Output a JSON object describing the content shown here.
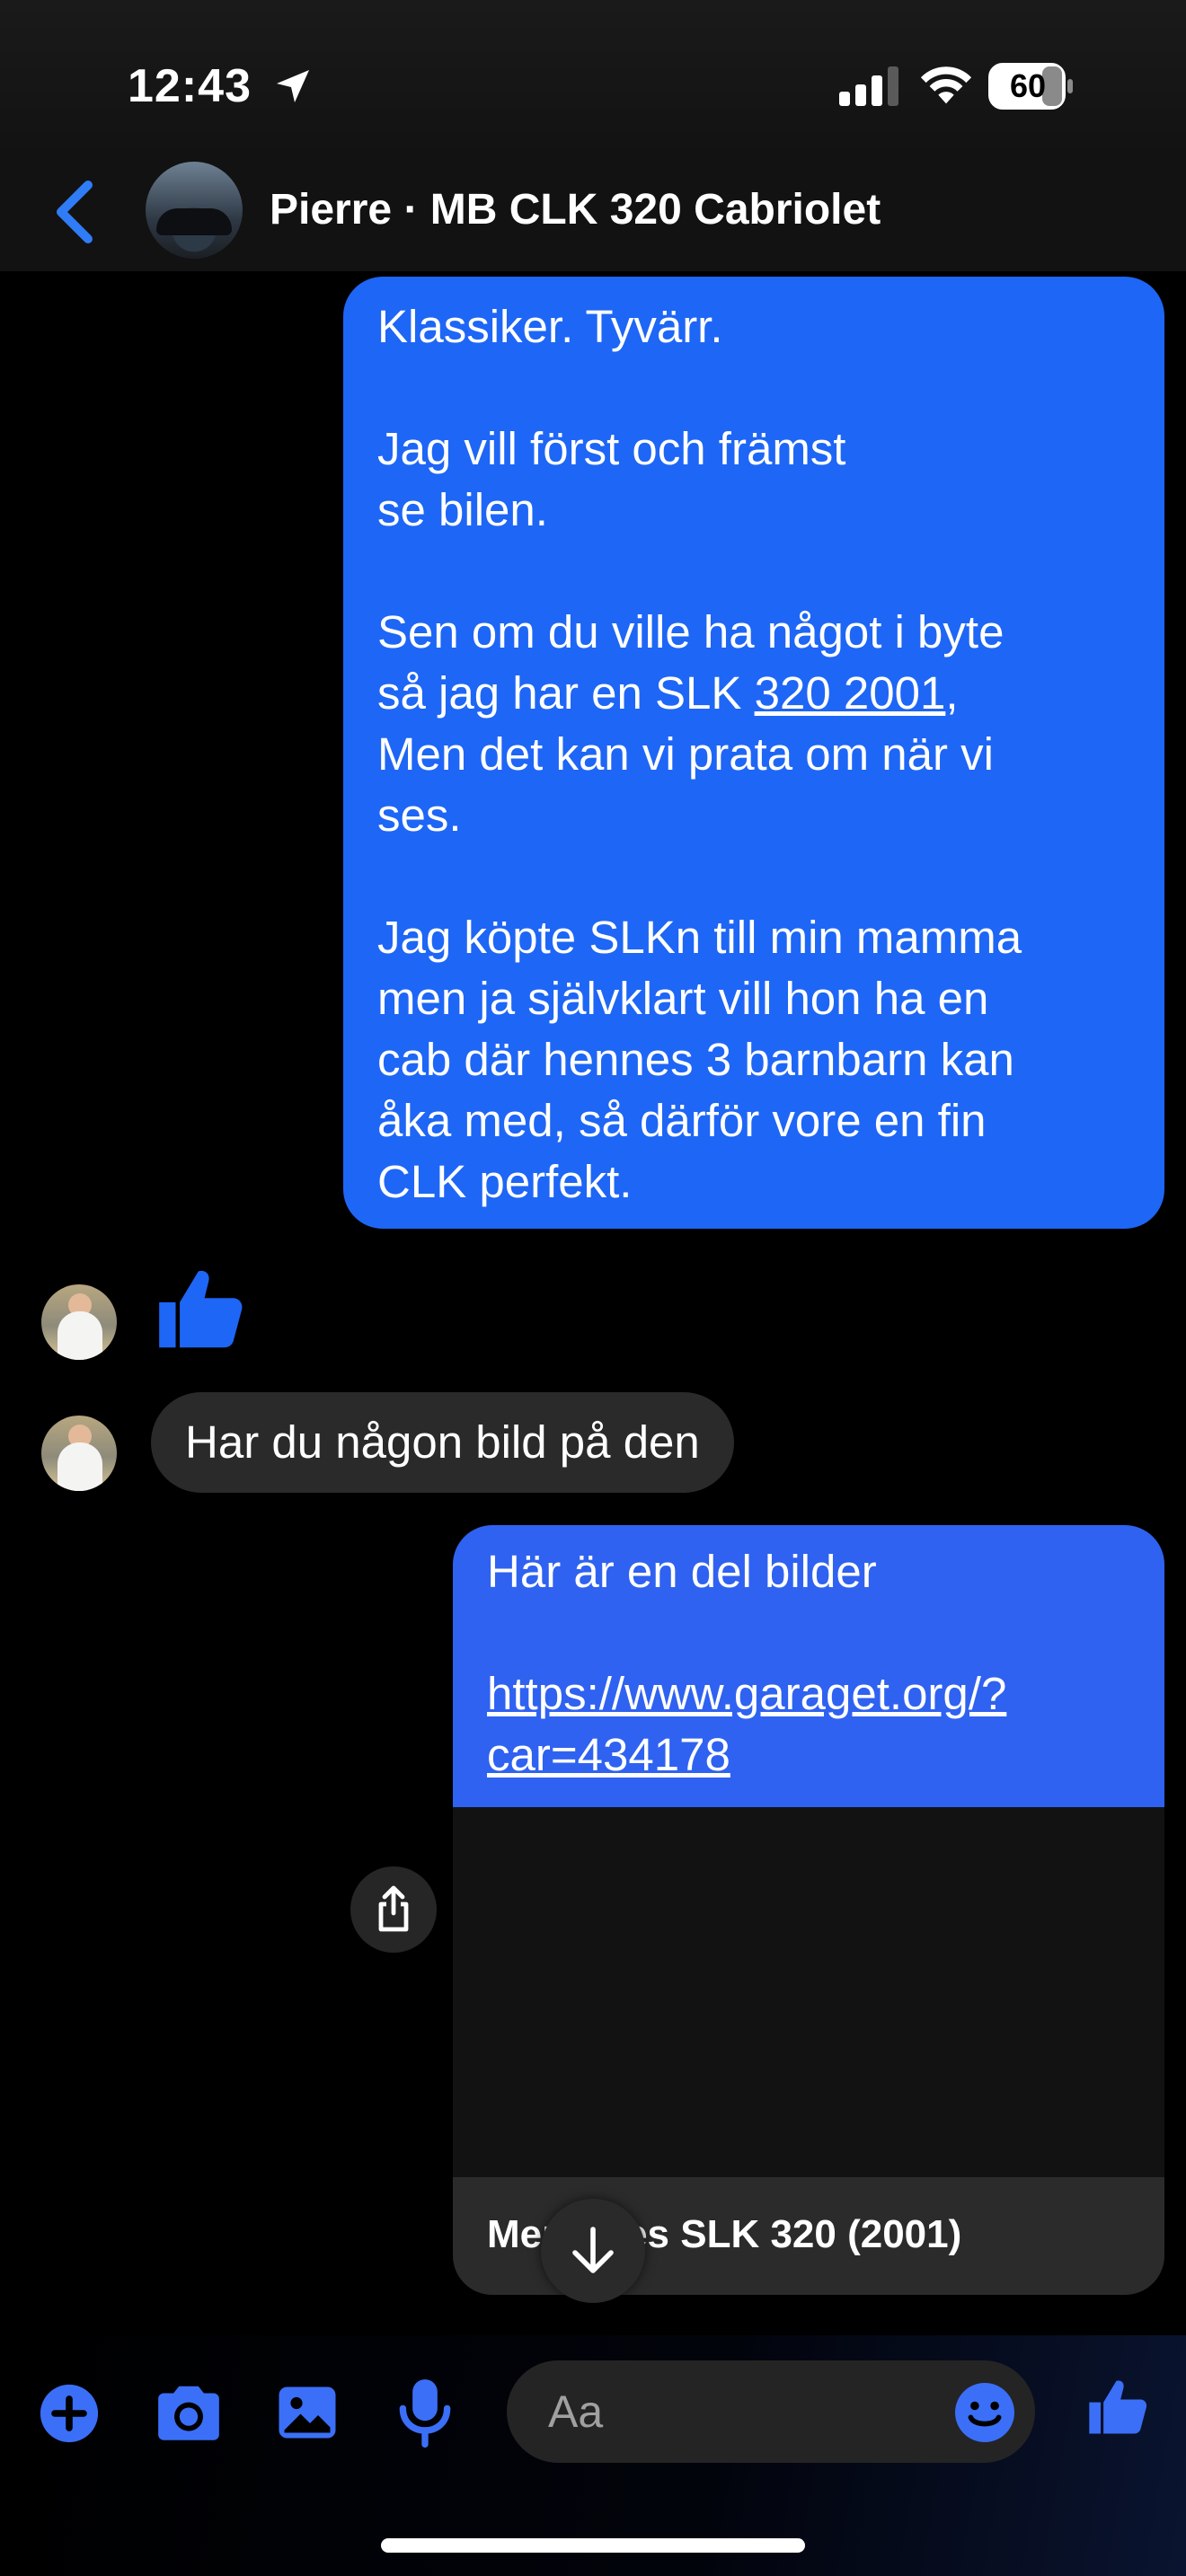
{
  "status_bar": {
    "time": "12:43",
    "battery": "60",
    "icons": [
      "location-arrow-icon",
      "cellular-signal-icon",
      "wifi-icon",
      "battery-icon"
    ]
  },
  "header": {
    "title": "Pierre · MB CLK 320 Cabriolet",
    "back_icon": "chevron-left-icon"
  },
  "messages": {
    "m1": {
      "before_link": "Klassiker. Tyvärr.\n\nJag vill först och främst\nse bilen.\n\nSen om du ville ha något i byte\nså jag har en SLK ",
      "link": "320 2001",
      "after_link": ",\nMen det kan vi prata om när vi\nses.\n\nJag köpte SLKn till min mamma\nmen ja självklart vill hon ha en\ncab där hennes 3 barnbarn kan\nåka med, så därför vore en fin\nCLK perfekt."
    },
    "m2": {
      "type": "like",
      "icon": "thumbs-up-icon"
    },
    "m3": {
      "text": "Har du någon bild på den"
    },
    "m4": {
      "text": "Här är en del bilder",
      "url": "https://www.garaget.org/?\ncar=434178",
      "caption": "Mercedes SLK 320 (2001)"
    }
  },
  "composer": {
    "placeholder": "Aa",
    "icons": [
      "plus-icon",
      "camera-icon",
      "image-icon",
      "microphone-icon",
      "emoji-icon",
      "thumbs-up-icon"
    ]
  },
  "colors": {
    "outgoing_bubble": "#1e66f5",
    "incoming_bubble": "#2a2a2a",
    "accent": "#2f62f0"
  }
}
